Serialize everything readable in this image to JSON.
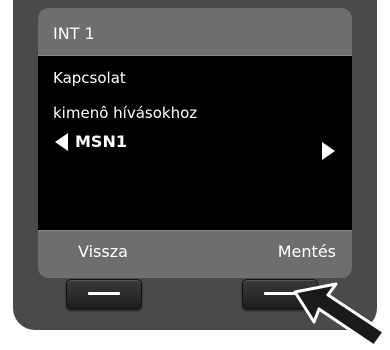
{
  "header": {
    "title": "INT 1"
  },
  "content": {
    "line1": "Kapcsolat",
    "line2": "kimenô hívásokhoz",
    "selector_value": "MSN1"
  },
  "softkeys": {
    "left_label": "Vissza",
    "right_label": "Mentés"
  },
  "icons": {
    "left_arrow": "triangle-left-icon",
    "right_arrow": "triangle-right-icon",
    "pointer": "pointer-arrow-icon"
  },
  "colors": {
    "frame": "#4a4a4a",
    "screen": "#000000",
    "bar": "#6e6e6e",
    "text": "#ffffff"
  }
}
